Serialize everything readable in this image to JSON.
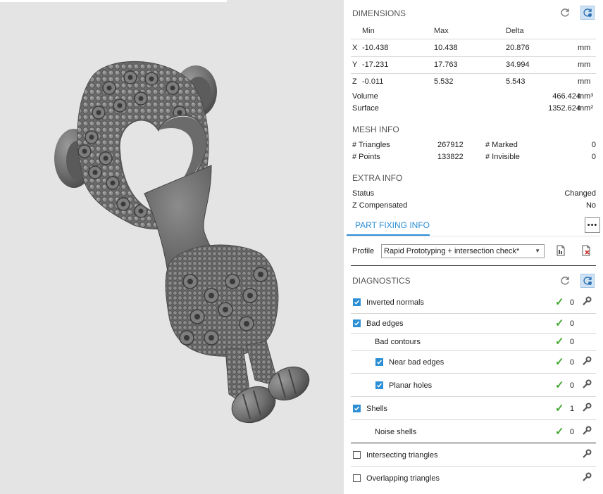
{
  "dimensions": {
    "title": "DIMENSIONS",
    "columns": [
      "Min",
      "Max",
      "Delta"
    ],
    "rows": [
      {
        "axis": "X",
        "min": "-10.438",
        "max": "10.438",
        "delta": "20.876",
        "unit": "mm"
      },
      {
        "axis": "Y",
        "min": "-17.231",
        "max": "17.763",
        "delta": "34.994",
        "unit": "mm"
      },
      {
        "axis": "Z",
        "min": "-0.011",
        "max": "5.532",
        "delta": "5.543",
        "unit": "mm"
      }
    ],
    "volume": {
      "label": "Volume",
      "value": "466.424",
      "unit": "mm³"
    },
    "surface": {
      "label": "Surface",
      "value": "1352.624",
      "unit": "mm²"
    }
  },
  "mesh_info": {
    "title": "MESH INFO",
    "triangles": {
      "label": "# Triangles",
      "value": "267912"
    },
    "points": {
      "label": "# Points",
      "value": "133822"
    },
    "marked": {
      "label": "# Marked",
      "value": "0"
    },
    "invisible": {
      "label": "# Invisible",
      "value": "0"
    }
  },
  "extra_info": {
    "title": "EXTRA INFO",
    "status": {
      "label": "Status",
      "value": "Changed"
    },
    "z_compensated": {
      "label": "Z Compensated",
      "value": "No"
    }
  },
  "part_fixing": {
    "tab_label": "PART FIXING INFO",
    "more_label": "•••",
    "profile_label": "Profile",
    "profile_value": "Rapid Prototyping + intersection check*"
  },
  "diagnostics": {
    "title": "DIAGNOSTICS",
    "items": [
      {
        "label": "Inverted normals",
        "count": "0"
      },
      {
        "label": "Bad edges",
        "count": "0"
      },
      {
        "label": "Bad contours",
        "count": "0"
      },
      {
        "label": "Near bad edges",
        "count": "0"
      },
      {
        "label": "Planar holes",
        "count": "0"
      },
      {
        "label": "Shells",
        "count": "1"
      },
      {
        "label": "Noise shells",
        "count": "0"
      },
      {
        "label": "Intersecting triangles",
        "count": ""
      },
      {
        "label": "Overlapping triangles",
        "count": ""
      }
    ]
  },
  "colors": {
    "accent": "#2c8fd6",
    "ok": "#45a832",
    "viewport_bg": "#e4e4e4"
  },
  "icons": [
    "refresh-icon",
    "auto-refresh-icon",
    "export-report-icon",
    "clear-report-icon",
    "wrench-icon",
    "checkmark-icon"
  ]
}
